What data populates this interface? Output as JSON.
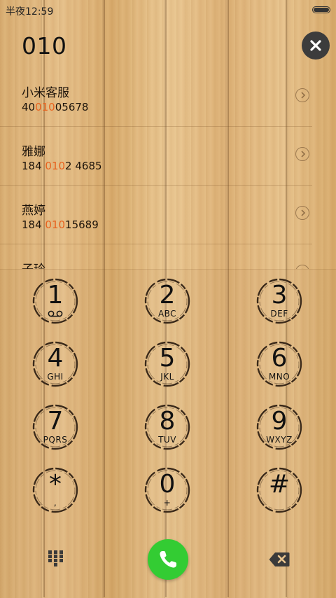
{
  "status": {
    "time": "半夜12:59"
  },
  "dial": {
    "number": "010"
  },
  "contacts": [
    {
      "name": "小米客服",
      "pre": "40",
      "hl": "010",
      "post": "05678"
    },
    {
      "name": "雅娜",
      "pre": "184 ",
      "hl": "010",
      "post": "2 4685"
    },
    {
      "name": "燕婷",
      "pre": "184 ",
      "hl": "010",
      "post": "15689"
    },
    {
      "name": "子玲",
      "pre": "",
      "hl": "",
      "post": ""
    }
  ],
  "keys": [
    {
      "digit": "1",
      "letters": "voicemail-icon"
    },
    {
      "digit": "2",
      "letters": "ABC"
    },
    {
      "digit": "3",
      "letters": "DEF"
    },
    {
      "digit": "4",
      "letters": "GHI"
    },
    {
      "digit": "5",
      "letters": "JKL"
    },
    {
      "digit": "6",
      "letters": "MNO"
    },
    {
      "digit": "7",
      "letters": "PQRS"
    },
    {
      "digit": "8",
      "letters": "TUV"
    },
    {
      "digit": "9",
      "letters": "WXYZ"
    },
    {
      "digit": "*",
      "letters": ","
    },
    {
      "digit": "0",
      "letters": "+"
    },
    {
      "digit": "#",
      "letters": ""
    }
  ],
  "colors": {
    "call": "#33cc33",
    "highlight": "#e8621e"
  },
  "icons": {
    "clear": "close-icon",
    "dialpad": "dialpad-icon",
    "call": "phone-icon",
    "backspace": "backspace-icon",
    "battery": "battery-icon"
  }
}
